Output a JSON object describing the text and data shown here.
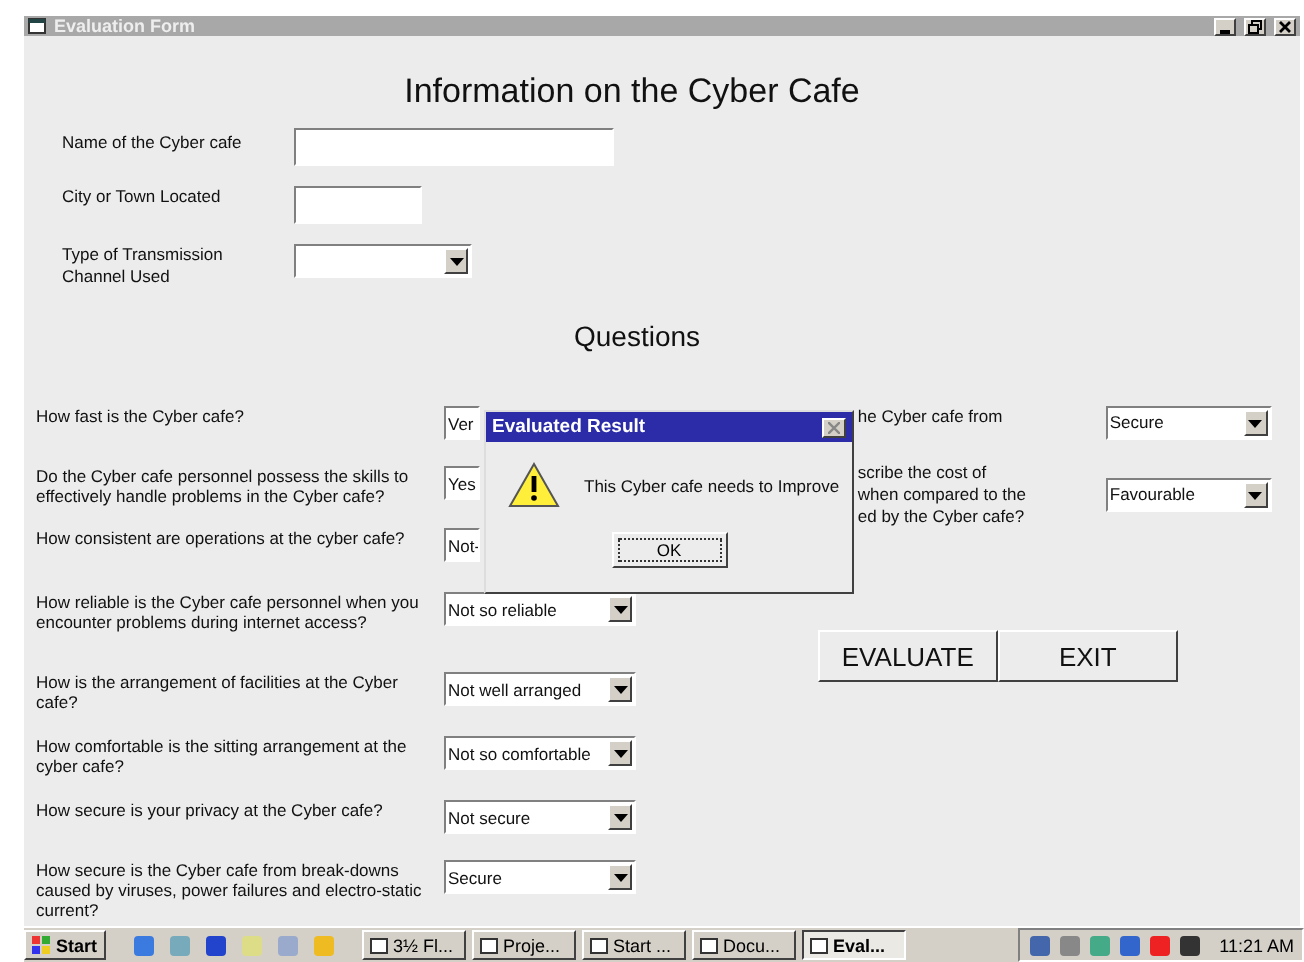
{
  "window": {
    "title": "Evaluation Form"
  },
  "heading": "Information on the Cyber Cafe",
  "info_fields": [
    {
      "kind": "text",
      "label": "Name of the Cyber cafe"
    },
    {
      "kind": "short",
      "label": "City or Town Located"
    },
    {
      "kind": "dropdown",
      "label": "Type of Transmission Channel Used"
    }
  ],
  "questions_heading": "Questions",
  "questions": [
    {
      "text": "How fast is the Cyber cafe?",
      "answer": "Ver",
      "kind": "partial"
    },
    {
      "text": "Do the Cyber cafe personnel possess the skills to effectively handle problems in the Cyber cafe?",
      "answer": "Yes",
      "kind": "partial"
    },
    {
      "text": "How consistent are operations at the cyber cafe?",
      "answer": "Not-",
      "kind": "partial"
    },
    {
      "text": "How reliable is the Cyber cafe personnel when you encounter problems during internet access?",
      "answer": "Not so reliable",
      "kind": "dropdown"
    },
    {
      "text": "How is the arrangement of facilities at the Cyber cafe?",
      "answer": "Not well arranged",
      "kind": "dropdown"
    },
    {
      "text": "How comfortable is the sitting arrangement at the cyber cafe?",
      "answer": "Not so comfortable",
      "kind": "dropdown"
    },
    {
      "text": "How secure is your privacy at the Cyber cafe?",
      "answer": "Not secure",
      "kind": "dropdown"
    },
    {
      "text": "How secure is the Cyber cafe from break-downs caused by viruses, power failures and electro-static current?",
      "answer": "Secure",
      "kind": "dropdown"
    }
  ],
  "side_questions": [
    {
      "lines": [
        "he Cyber cafe from"
      ],
      "answer": "Secure"
    },
    {
      "lines": [
        "scribe the cost of",
        "when compared to the",
        "ed by the Cyber cafe?"
      ],
      "answer": "Favourable"
    }
  ],
  "buttons": [
    "EVALUATE",
    "EXIT"
  ],
  "dialog": {
    "title": "Evaluated Result",
    "message": "This Cyber cafe needs to Improve",
    "button": "OK"
  },
  "taskbar": {
    "start": "Start",
    "tasks": [
      {
        "label": "3½ Fl...",
        "selected": false
      },
      {
        "label": "Proje...",
        "selected": false
      },
      {
        "label": "Start ...",
        "selected": false
      },
      {
        "label": "Docu...",
        "selected": false
      },
      {
        "label": "Eval...",
        "selected": true
      }
    ],
    "clock": "11:21 AM"
  }
}
